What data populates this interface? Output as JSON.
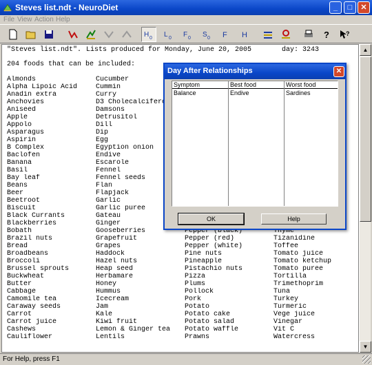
{
  "window": {
    "title": "Steves list.ndt - NeuroDiet",
    "controls": {
      "minimize": "_",
      "maximize": "□",
      "close": "✕"
    }
  },
  "menu": [
    "File",
    "View",
    "Action",
    "Help"
  ],
  "toolbar": {
    "icons": [
      "new-file-icon",
      "open-folder-icon",
      "save-disk-icon",
      "graph-red-icon",
      "graph-green-icon",
      "graph-grey-icon",
      "graph-grey-2-icon",
      "h0-icon",
      "l0-icon",
      "f0-icon",
      "s0-icon",
      "f-icon",
      "h-icon",
      "list-icon",
      "balance-icon",
      "print-icon",
      "help-icon",
      "context-help-icon"
    ]
  },
  "document": {
    "header_left": "\"Steves list.ndt\".",
    "header_mid": "Lists produced for Monday, June 20, 2005",
    "header_right": "day: 3243",
    "summary": "204 foods that can be included:",
    "columns": [
      [
        "Almonds",
        "Alpha Lipoic Acid",
        "Anadin extra",
        "Anchovies",
        "Aniseed",
        "Apple",
        "Appolo",
        "Asparagus",
        "Aspirin",
        "B Complex",
        "Baclofen",
        "Banana",
        "Basil",
        "Bay leaf",
        "Beans",
        "Beer",
        "Beetroot",
        "Biscuit",
        "Black Currants",
        "Blackberries",
        "Bobath",
        "Brazil nuts",
        "Bread",
        "Broadbeans",
        "Broccoli",
        "Brussel sprouts",
        "Buckwheat",
        "Butter",
        "Cabbage",
        "Camomile tea",
        "Caraway seeds",
        "Carrot",
        "Carrot juice",
        "Cashews",
        "Cauliflower"
      ],
      [
        "Cucumber",
        "Cummin",
        "Curry",
        "D3 Cholecalciferol",
        "Damsons",
        "Detrusitol",
        "Dill",
        "Dip",
        "Egg",
        "Egyption onion",
        "Endive",
        "Escarole",
        "Fennel",
        "Fennel seeds",
        "Flan",
        "Flapjack",
        "Garlic",
        "Garlic puree",
        "Gateau",
        "Ginger",
        "Gooseberries",
        "Grapefruit",
        "Grapes",
        "Haddock",
        "Hazel nuts",
        "Heap seed",
        "Herbamare",
        "Honey",
        "Hummus",
        "Icecream",
        "Jam",
        "Kale",
        "Kiwi fruit",
        "Lemon & Ginger tea",
        "Lentils"
      ],
      [
        "Pepper (black)",
        "Pepper (red)",
        "Pepper (white)",
        "Pine nuts",
        "Pineapple",
        "Pistachio nuts",
        "Pizza",
        "Plums",
        "Pollock",
        "Pork",
        "Potato",
        "Potato cake",
        "Potato salad",
        "Potato waffle",
        "Prawns"
      ],
      [
        "Thyme",
        "Tizanidine",
        "Toffee",
        "Tomato juice",
        "Tomato ketchup",
        "Tomato puree",
        "Tortilla",
        "Trimethoprim",
        "Tuna",
        "Turkey",
        "Turmeric",
        "Vege juice",
        "Vinegar",
        "Vit C",
        "Watercress"
      ]
    ]
  },
  "status": {
    "text": "For Help, press F1"
  },
  "dialog": {
    "title": "Day After Relationships",
    "close": "✕",
    "headers": [
      "Symptom",
      "Best food",
      "Worst food"
    ],
    "rows": [
      [
        "Balance",
        "Endive",
        "Sardines"
      ]
    ],
    "ok_label": "OK",
    "help_label": "Help"
  }
}
